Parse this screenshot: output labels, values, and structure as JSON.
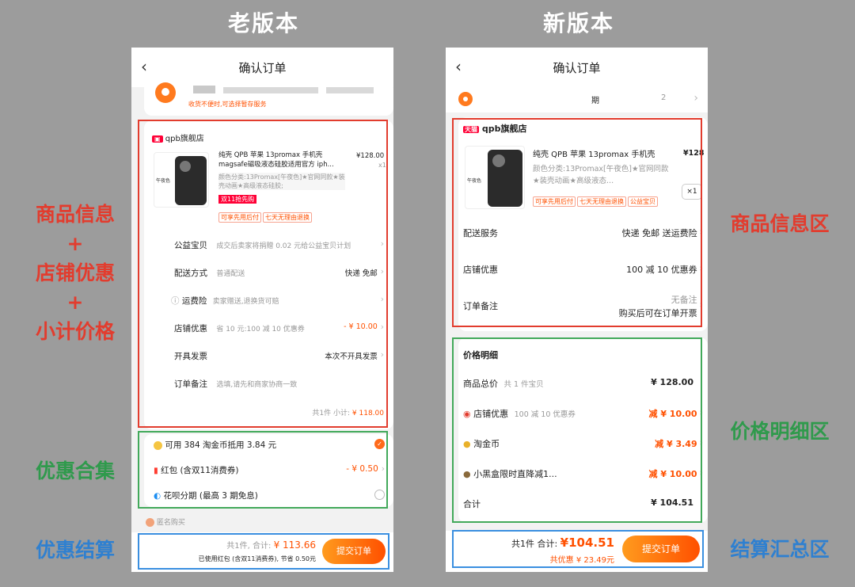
{
  "headers": {
    "old": "老版本",
    "new": "新版本"
  },
  "nav_title": "确认订单",
  "old": {
    "address_note": "收货不便时,可选择暂存服务",
    "store": "qpb旗舰店",
    "product_title": "纯壳 QPB 苹果 13promax 手机壳 magsafe磁吸液态硅胶适用官方 iph...",
    "product_sku": "颜色分类:13Promax[午夜色]★官网同款★装壳动画★高级液态硅胶;",
    "price": "¥128.00",
    "qty": "x1",
    "promo_badge": "双11抢先购",
    "tags": [
      "可享先用后付",
      "七天无理由退换"
    ],
    "rows": [
      {
        "label": "公益宝贝",
        "value": "成交后卖家将捐赠 0.02 元给公益宝贝计划",
        "right": ""
      },
      {
        "label": "配送方式",
        "value": "普通配送",
        "right": "快递 免邮"
      },
      {
        "label": "运费险",
        "value": "卖家赠送,退换货可赔",
        "right": ""
      },
      {
        "label": "店铺优惠",
        "value": "省 10 元:100 减 10 优惠券",
        "right": "- ¥ 10.00"
      },
      {
        "label": "开具发票",
        "value": "",
        "right": "本次不开具发票"
      },
      {
        "label": "订单备注",
        "value": "选填,请先和商家协商一致",
        "right": ""
      }
    ],
    "subtotal_prefix": "共1件 小计:",
    "subtotal": "¥ 118.00",
    "coupons": [
      {
        "label": "可用 384 淘金币抵用 3.84 元",
        "right": ""
      },
      {
        "label": "红包 (含双11消费券)",
        "right": "- ¥ 0.50"
      },
      {
        "label": "花呗分期 (最高 3 期免息)",
        "right": ""
      }
    ],
    "anonymous": "匿名购买",
    "footer_prefix": "共1件, 合计:",
    "footer_total": "¥ 113.66",
    "footer_note": "已使用红包 (含双11消费券), 节省 0.50元",
    "submit": "提交订单"
  },
  "new": {
    "address_text": "期",
    "address_tail": "2",
    "store": "qpb旗舰店",
    "tmall": "天猫",
    "product_title": "纯壳 QPB 苹果 13promax 手机壳",
    "product_sku": "颜色分类:13Promax[午夜色]★官网同款★装壳动画★高级液态...",
    "price": "¥128",
    "qty": "×1",
    "tags": [
      "可享先用后付",
      "七天无理由退换",
      "公益宝贝"
    ],
    "rows": [
      {
        "label": "配送服务",
        "right": "快递 免邮 送运费险"
      },
      {
        "label": "店铺优惠",
        "right": "100 减 10 优惠券"
      },
      {
        "label": "订单备注",
        "right1": "无备注",
        "right2": "购买后可在订单开票"
      }
    ],
    "price_detail_title": "价格明细",
    "price_rows": [
      {
        "label": "商品总价",
        "sub": "共 1 件宝贝",
        "right": "¥ 128.00"
      },
      {
        "label": "店铺优惠",
        "sub": "100 减 10 优惠券",
        "right": "减 ¥ 10.00"
      },
      {
        "label": "淘金币",
        "sub": "",
        "right": "减 ¥ 3.49"
      },
      {
        "label": "小黑盒限时直降减1...",
        "sub": "",
        "right": "减 ¥ 10.00"
      },
      {
        "label": "合计",
        "sub": "",
        "right": "¥ 104.51"
      }
    ],
    "footer_prefix": "共1件 合计:",
    "footer_total": "¥104.51",
    "footer_save": "共优惠 ¥ 23.49元",
    "submit": "提交订单"
  },
  "labels": {
    "left": [
      "商品信息",
      "+",
      "店铺优惠",
      "+",
      "小计价格"
    ],
    "left_green": "优惠合集",
    "left_blue": "优惠结算",
    "right_red": "商品信息区",
    "right_green": "价格明细区",
    "right_blue": "结算汇总区"
  }
}
